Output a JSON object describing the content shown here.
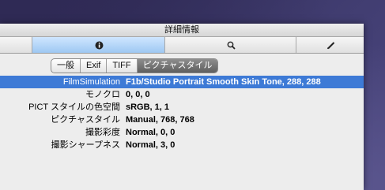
{
  "window": {
    "title": "詳細情報"
  },
  "toolbar": {
    "segments": [
      {
        "icon": "info-icon",
        "active": true
      },
      {
        "icon": "search-icon",
        "active": false
      },
      {
        "icon": "pen-icon",
        "active": false
      }
    ]
  },
  "tabs": [
    {
      "label": "一般",
      "selected": false
    },
    {
      "label": "Exif",
      "selected": false
    },
    {
      "label": "TIFF",
      "selected": false
    },
    {
      "label": "ピクチャスタイル",
      "selected": true
    }
  ],
  "properties": [
    {
      "key": "FilmSimulation",
      "value": "F1b/Studio Portrait Smooth Skin Tone, 288, 288",
      "selected": true
    },
    {
      "key": "モノクロ",
      "value": "0, 0, 0",
      "selected": false
    },
    {
      "key": "PICT スタイルの色空間",
      "value": "sRGB, 1, 1",
      "selected": false
    },
    {
      "key": "ピクチャスタイル",
      "value": "Manual, 768, 768",
      "selected": false
    },
    {
      "key": "撮影彩度",
      "value": "Normal, 0, 0",
      "selected": false
    },
    {
      "key": "撮影シャープネス",
      "value": "Normal, 3, 0",
      "selected": false
    }
  ],
  "colors": {
    "selection": "#3d7ad6",
    "active_segment": "#aed3f7",
    "desktop": "#3d3766"
  }
}
